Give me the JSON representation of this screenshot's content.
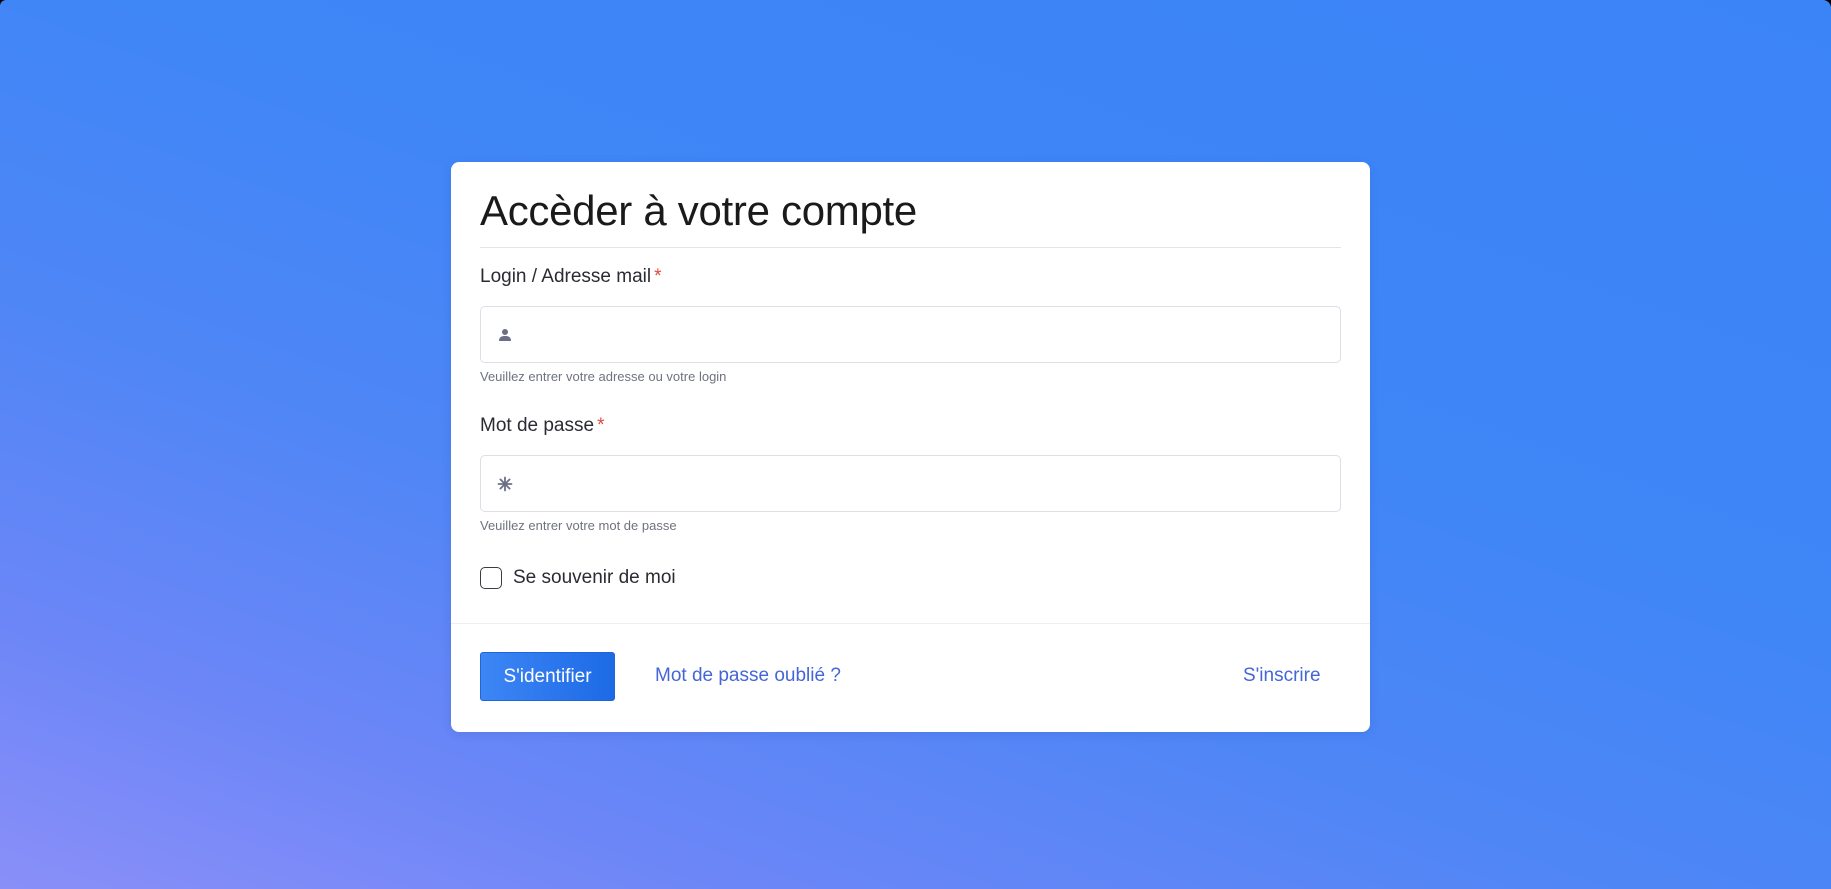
{
  "login_card": {
    "title": "Accèder à votre compte",
    "login_field": {
      "label": "Login / Adresse mail",
      "required_mark": "*",
      "value": "",
      "help_text": "Veuillez entrer votre adresse ou votre login",
      "icon": "user-icon"
    },
    "password_field": {
      "label": "Mot de passe",
      "required_mark": "*",
      "value": "",
      "help_text": "Veuillez entrer votre mot de passe",
      "icon": "asterisk-icon"
    },
    "remember_me": {
      "label": "Se souvenir de moi",
      "checked": false
    },
    "actions": {
      "submit_label": "S'identifier",
      "forgot_password_label": "Mot de passe oublié ?",
      "register_label": "S'inscrire"
    }
  },
  "colors": {
    "background_gradient_start": "#8a8ff8",
    "background_gradient_end": "#3b84f7",
    "primary_button": "#2a77ee",
    "link": "#4466d6",
    "required_mark": "#e0483e"
  }
}
